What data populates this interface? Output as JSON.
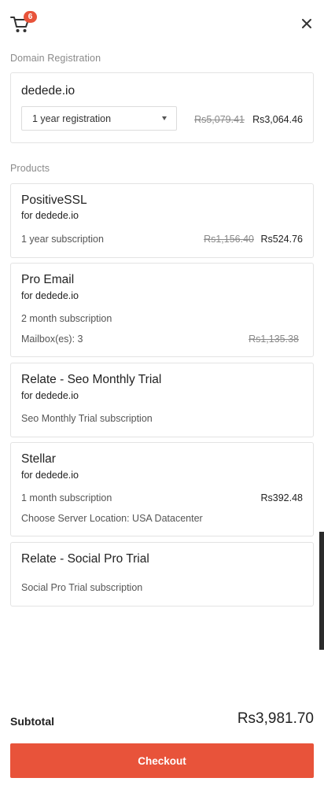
{
  "header": {
    "cart_count": "6",
    "cart_icon": "cart-icon",
    "close_icon": "close-icon"
  },
  "domain_section": {
    "label": "Domain Registration",
    "domain": "dedede.io",
    "term_select": {
      "value": "1 year registration"
    },
    "price_old": "Rs5,079.41",
    "price_new": "Rs3,064.46"
  },
  "products_section": {
    "label": "Products",
    "items": [
      {
        "title": "PositiveSSL",
        "for": "for dedede.io",
        "subscription": "1 year subscription",
        "price_old": "Rs1,156.40",
        "price_new": "Rs524.76"
      },
      {
        "title": "Pro Email",
        "for": "for dedede.io",
        "subscription": "2 month subscription",
        "extra": "Mailbox(es): 3",
        "price_old": "Rs1,135.38"
      },
      {
        "title": "Relate - Seo Monthly Trial",
        "for": "for dedede.io",
        "subscription": "Seo Monthly Trial subscription"
      },
      {
        "title": "Stellar",
        "for": "for dedede.io",
        "subscription": "1 month subscription",
        "price_new": "Rs392.48",
        "extra": "Choose Server Location: USA Datacenter"
      },
      {
        "title": "Relate - Social Pro Trial",
        "subscription": "Social Pro Trial subscription"
      }
    ]
  },
  "footer": {
    "subtotal_label": "Subtotal",
    "subtotal_value": "Rs3,981.70",
    "checkout_label": "Checkout"
  },
  "colors": {
    "accent": "#e8533a",
    "border": "#e3e3e3",
    "muted_text": "#8a8a8a"
  }
}
